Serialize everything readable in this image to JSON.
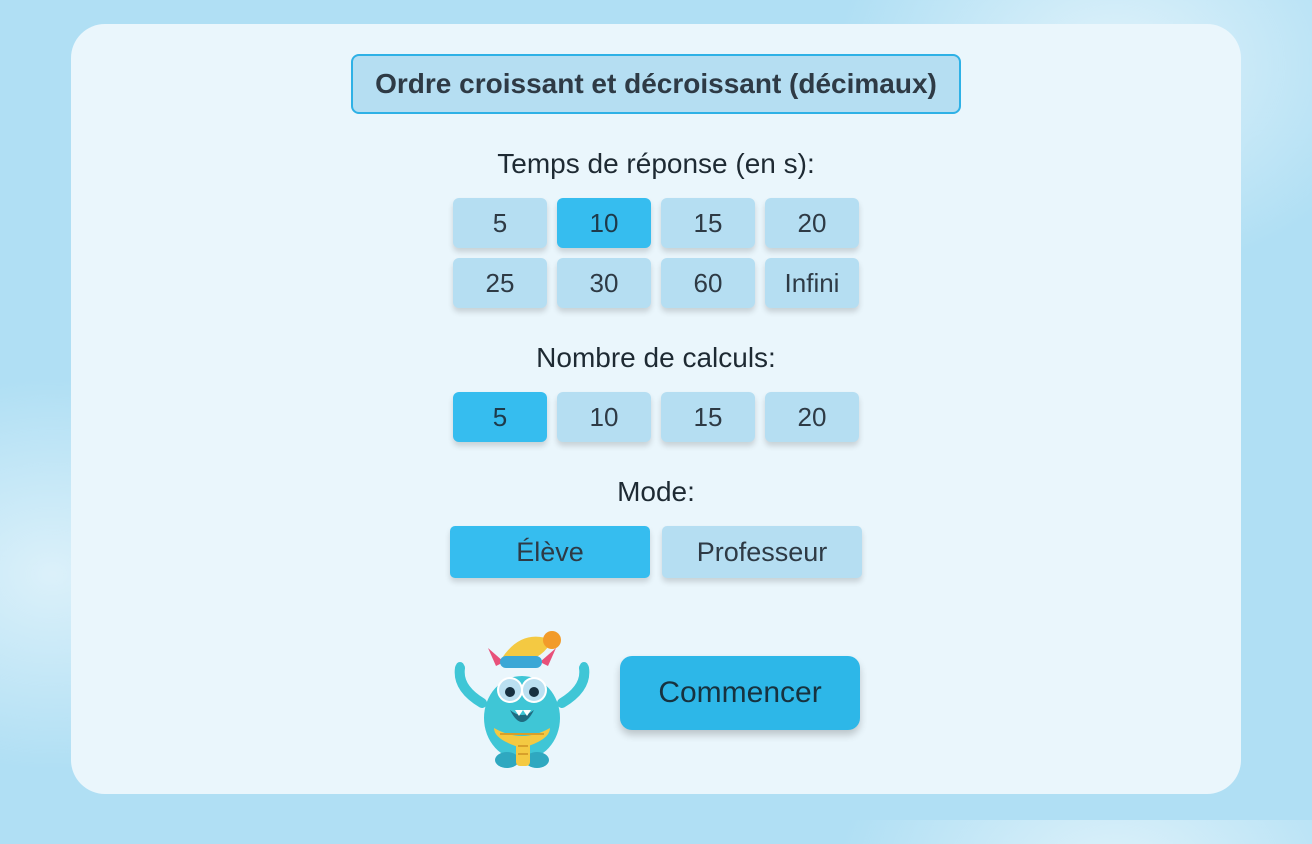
{
  "title": "Ordre croissant et décroissant (décimaux)",
  "time": {
    "label": "Temps de réponse (en s):",
    "options": [
      "5",
      "10",
      "15",
      "20",
      "25",
      "30",
      "60",
      "Infini"
    ],
    "selected": "10"
  },
  "count": {
    "label": "Nombre de calculs:",
    "options": [
      "5",
      "10",
      "15",
      "20"
    ],
    "selected": "5"
  },
  "mode": {
    "label": "Mode:",
    "options": [
      "Élève",
      "Professeur"
    ],
    "selected": "Élève"
  },
  "start_label": "Commencer"
}
